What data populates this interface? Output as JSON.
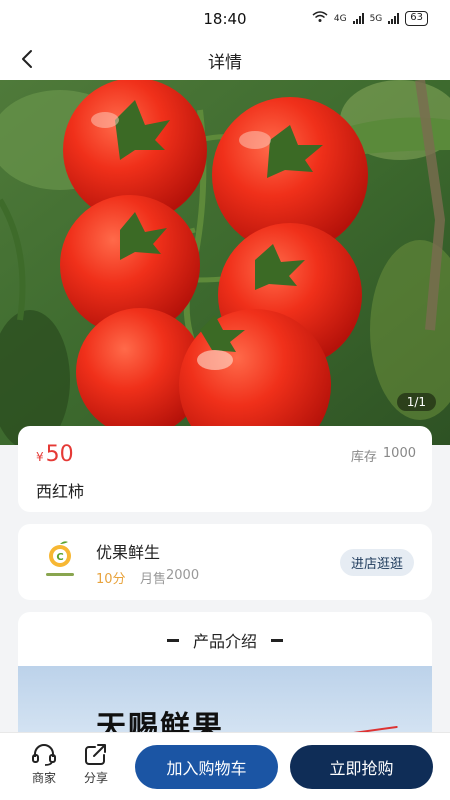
{
  "status_bar": {
    "time": "18:40",
    "network_1": "4G",
    "network_2": "5G",
    "battery": "63",
    "wifi_badge": "6"
  },
  "header": {
    "title": "详情"
  },
  "hero": {
    "page_indicator": "1/1"
  },
  "product": {
    "currency": "¥",
    "price": "50",
    "stock_label": "库存",
    "stock_value": "1000",
    "name": "西红柿"
  },
  "shop": {
    "name": "优果鲜生",
    "rating": "10分",
    "sales_label": "月售",
    "sales_value": "2000",
    "visit_label": "进店逛逛"
  },
  "intro": {
    "title": "产品介绍",
    "banner_text": "天赐鲜果"
  },
  "bottom_bar": {
    "merchant_label": "商家",
    "share_label": "分享",
    "cart_label": "加入购物车",
    "buy_label": "立即抢购"
  },
  "colors": {
    "price_red": "#e53935",
    "cart_blue": "#1b55a4",
    "buy_navy": "#0f2d57",
    "rating_orange": "#e8a33d"
  }
}
